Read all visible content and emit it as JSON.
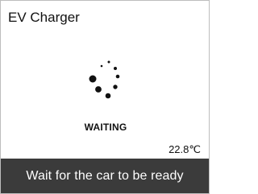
{
  "app": {
    "title": "EV Charger"
  },
  "status": {
    "label": "WAITING",
    "spinner_icon": "loading-dots-icon"
  },
  "temperature": {
    "value": "22.8",
    "unit": "℃"
  },
  "footer": {
    "message": "Wait for the car to be ready"
  },
  "colors": {
    "background": "#ffffff",
    "text": "#111111",
    "footer_background": "#3b3b3b",
    "footer_text": "#ffffff",
    "spinner": "#111111"
  }
}
